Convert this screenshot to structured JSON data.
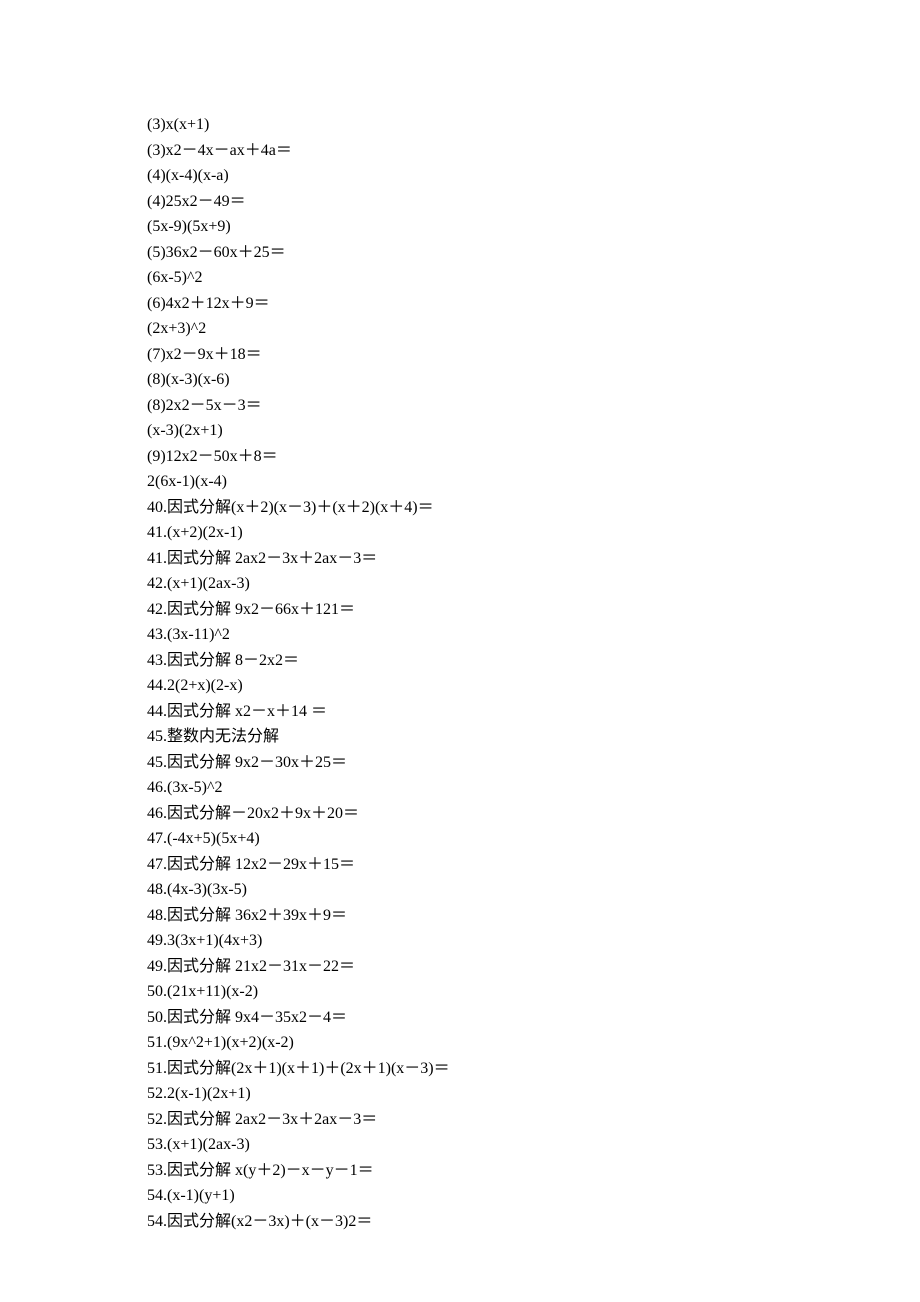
{
  "lines": [
    "(3)x(x+1)",
    "(3)x2－4x－ax＋4a＝",
    "(4)(x-4)(x-a)",
    "(4)25x2－49＝",
    "(5x-9)(5x+9)",
    "(5)36x2－60x＋25＝",
    "(6x-5)^2",
    "(6)4x2＋12x＋9＝",
    "(2x+3)^2",
    "(7)x2－9x＋18＝",
    "(8)(x-3)(x-6)",
    "(8)2x2－5x－3＝",
    "(x-3)(2x+1)",
    "(9)12x2－50x＋8＝",
    "2(6x-1)(x-4)",
    "40.因式分解(x＋2)(x－3)＋(x＋2)(x＋4)＝",
    "41.(x+2)(2x-1)",
    "41.因式分解 2ax2－3x＋2ax－3＝",
    "42.(x+1)(2ax-3)",
    "42.因式分解 9x2－66x＋121＝",
    "43.(3x-11)^2",
    "43.因式分解 8－2x2＝",
    "44.2(2+x)(2-x)",
    "44.因式分解 x2－x＋14 ＝",
    "45.整数内无法分解",
    "45.因式分解 9x2－30x＋25＝",
    "46.(3x-5)^2",
    "46.因式分解－20x2＋9x＋20＝",
    "47.(-4x+5)(5x+4)",
    "47.因式分解 12x2－29x＋15＝",
    "48.(4x-3)(3x-5)",
    "48.因式分解 36x2＋39x＋9＝",
    "49.3(3x+1)(4x+3)",
    "49.因式分解 21x2－31x－22＝",
    "50.(21x+11)(x-2)",
    "50.因式分解 9x4－35x2－4＝",
    "51.(9x^2+1)(x+2)(x-2)",
    "51.因式分解(2x＋1)(x＋1)＋(2x＋1)(x－3)＝",
    "52.2(x-1)(2x+1)",
    "52.因式分解 2ax2－3x＋2ax－3＝",
    "53.(x+1)(2ax-3)",
    "53.因式分解 x(y＋2)－x－y－1＝",
    "54.(x-1)(y+1)",
    "54.因式分解(x2－3x)＋(x－3)2＝"
  ]
}
